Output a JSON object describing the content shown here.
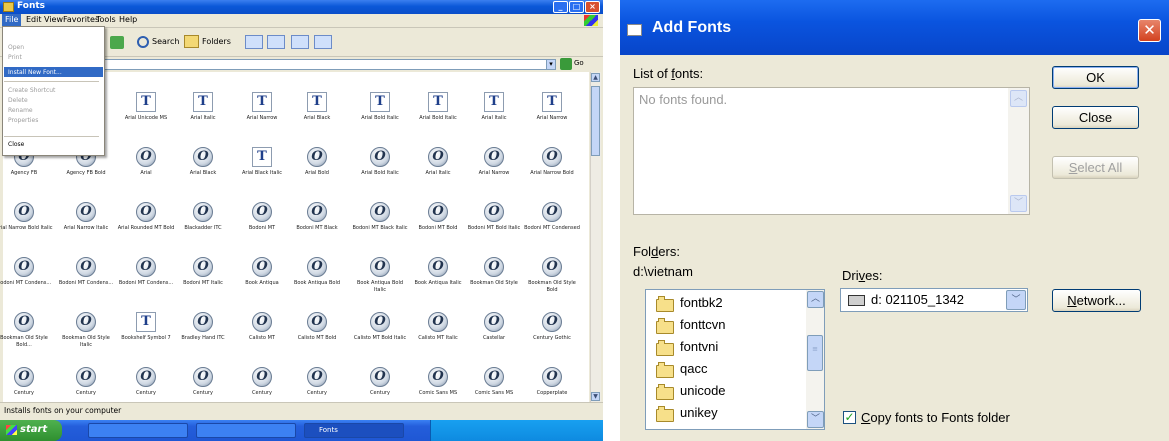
{
  "explorer": {
    "title": "Fonts",
    "menus": [
      "File",
      "Edit",
      "View",
      "Favorites",
      "Tools",
      "Help"
    ],
    "toolbar": {
      "search_label": "Search",
      "folders_label": "Folders"
    },
    "file_menu": {
      "items": [
        {
          "label": "Open",
          "enabled": false
        },
        {
          "label": "Print",
          "enabled": false
        },
        {
          "label": "Install New Font...",
          "enabled": true,
          "highlighted": true
        },
        {
          "label": "Create Shortcut",
          "enabled": false
        },
        {
          "label": "Delete",
          "enabled": false
        },
        {
          "label": "Rename",
          "enabled": false
        },
        {
          "label": "Properties",
          "enabled": false
        },
        {
          "label": "Close",
          "enabled": true
        }
      ]
    },
    "address_go": "Go",
    "fonts": [
      {
        "label": "",
        "icon": "truetype"
      },
      {
        "label": "",
        "icon": "truetype"
      },
      {
        "label": "Arial Unicode MS",
        "icon": "truetype"
      },
      {
        "label": "Arial Italic",
        "icon": "truetype"
      },
      {
        "label": "Arial Narrow",
        "icon": "truetype"
      },
      {
        "label": "Arial Black",
        "icon": "truetype"
      },
      {
        "label": "Arial Bold Italic",
        "icon": "truetype"
      },
      {
        "label": "Arial Bold Italic",
        "icon": "truetype"
      },
      {
        "label": "Arial Italic",
        "icon": "truetype"
      },
      {
        "label": "Arial Narrow",
        "icon": "truetype"
      },
      {
        "label": "Agency FB",
        "icon": "opentype"
      },
      {
        "label": "Agency FB Bold",
        "icon": "opentype"
      },
      {
        "label": "Arial",
        "icon": "opentype"
      },
      {
        "label": "Arial Black",
        "icon": "opentype"
      },
      {
        "label": "Arial Black Italic",
        "icon": "truetype"
      },
      {
        "label": "Arial Bold",
        "icon": "opentype"
      },
      {
        "label": "Arial Bold Italic",
        "icon": "opentype"
      },
      {
        "label": "Arial Italic",
        "icon": "opentype"
      },
      {
        "label": "Arial Narrow",
        "icon": "opentype"
      },
      {
        "label": "Arial Narrow Bold",
        "icon": "opentype"
      },
      {
        "label": "Arial Narrow Bold Italic",
        "icon": "opentype"
      },
      {
        "label": "Arial Narrow Italic",
        "icon": "opentype"
      },
      {
        "label": "Arial Rounded MT Bold",
        "icon": "opentype"
      },
      {
        "label": "Blackadder ITC",
        "icon": "opentype"
      },
      {
        "label": "Bodoni MT",
        "icon": "opentype"
      },
      {
        "label": "Bodoni MT Black",
        "icon": "opentype"
      },
      {
        "label": "Bodoni MT Black Italic",
        "icon": "opentype"
      },
      {
        "label": "Bodoni MT Bold",
        "icon": "opentype"
      },
      {
        "label": "Bodoni MT Bold Italic",
        "icon": "opentype"
      },
      {
        "label": "Bodoni MT Condensed",
        "icon": "opentype"
      },
      {
        "label": "Bodoni MT Condens...",
        "icon": "opentype"
      },
      {
        "label": "Bodoni MT Condens...",
        "icon": "opentype"
      },
      {
        "label": "Bodoni MT Condens...",
        "icon": "opentype"
      },
      {
        "label": "Bodoni MT Italic",
        "icon": "opentype"
      },
      {
        "label": "Book Antiqua",
        "icon": "opentype"
      },
      {
        "label": "Book Antiqua Bold",
        "icon": "opentype"
      },
      {
        "label": "Book Antiqua Bold Italic",
        "icon": "opentype"
      },
      {
        "label": "Book Antiqua Italic",
        "icon": "opentype"
      },
      {
        "label": "Bookman Old Style",
        "icon": "opentype"
      },
      {
        "label": "Bookman Old Style Bold",
        "icon": "opentype"
      },
      {
        "label": "Bookman Old Style Bold...",
        "icon": "opentype"
      },
      {
        "label": "Bookman Old Style Italic",
        "icon": "opentype"
      },
      {
        "label": "Bookshelf Symbol 7",
        "icon": "truetype"
      },
      {
        "label": "Bradley Hand ITC",
        "icon": "opentype"
      },
      {
        "label": "Calisto MT",
        "icon": "opentype"
      },
      {
        "label": "Calisto MT Bold",
        "icon": "opentype"
      },
      {
        "label": "Calisto MT Bold Italic",
        "icon": "opentype"
      },
      {
        "label": "Calisto MT Italic",
        "icon": "opentype"
      },
      {
        "label": "Castellar",
        "icon": "opentype"
      },
      {
        "label": "Century Gothic",
        "icon": "opentype"
      },
      {
        "label": "Century",
        "icon": "opentype"
      },
      {
        "label": "Century",
        "icon": "opentype"
      },
      {
        "label": "Century",
        "icon": "opentype"
      },
      {
        "label": "Century",
        "icon": "opentype"
      },
      {
        "label": "Century",
        "icon": "opentype"
      },
      {
        "label": "Century",
        "icon": "opentype"
      },
      {
        "label": "Century",
        "icon": "opentype"
      },
      {
        "label": "Comic Sans MS",
        "icon": "opentype"
      },
      {
        "label": "Comic Sans MS",
        "icon": "opentype"
      },
      {
        "label": "Copperplate",
        "icon": "opentype"
      }
    ],
    "status_text": "Installs fonts on your computer",
    "taskbar": {
      "start_label": "start",
      "tasks": [
        "",
        "",
        "Fonts"
      ]
    }
  },
  "dialog": {
    "title": "Add Fonts",
    "list_label_pre": "List of ",
    "list_label_u": "f",
    "list_label_post": "onts:",
    "list_empty": "No fonts found.",
    "ok_label": "OK",
    "close_label": "Close",
    "select_all_u": "S",
    "select_all_rest": "elect All",
    "folders_label_pre": "Fol",
    "folders_label_u": "d",
    "folders_label_post": "ers:",
    "current_path": "d:\\vietnam",
    "folders": [
      "fontbk2",
      "fonttcvn",
      "fontvni",
      "qacc",
      "unicode",
      "unikey"
    ],
    "drives_label_pre": "Dri",
    "drives_label_u": "v",
    "drives_label_post": "es:",
    "drive_value": "d: 021105_1342",
    "network_label_u": "N",
    "network_label_rest": "etwork...",
    "copy_check_u": "C",
    "copy_check_rest": "opy fonts to Fonts folder",
    "copy_checked": true
  }
}
